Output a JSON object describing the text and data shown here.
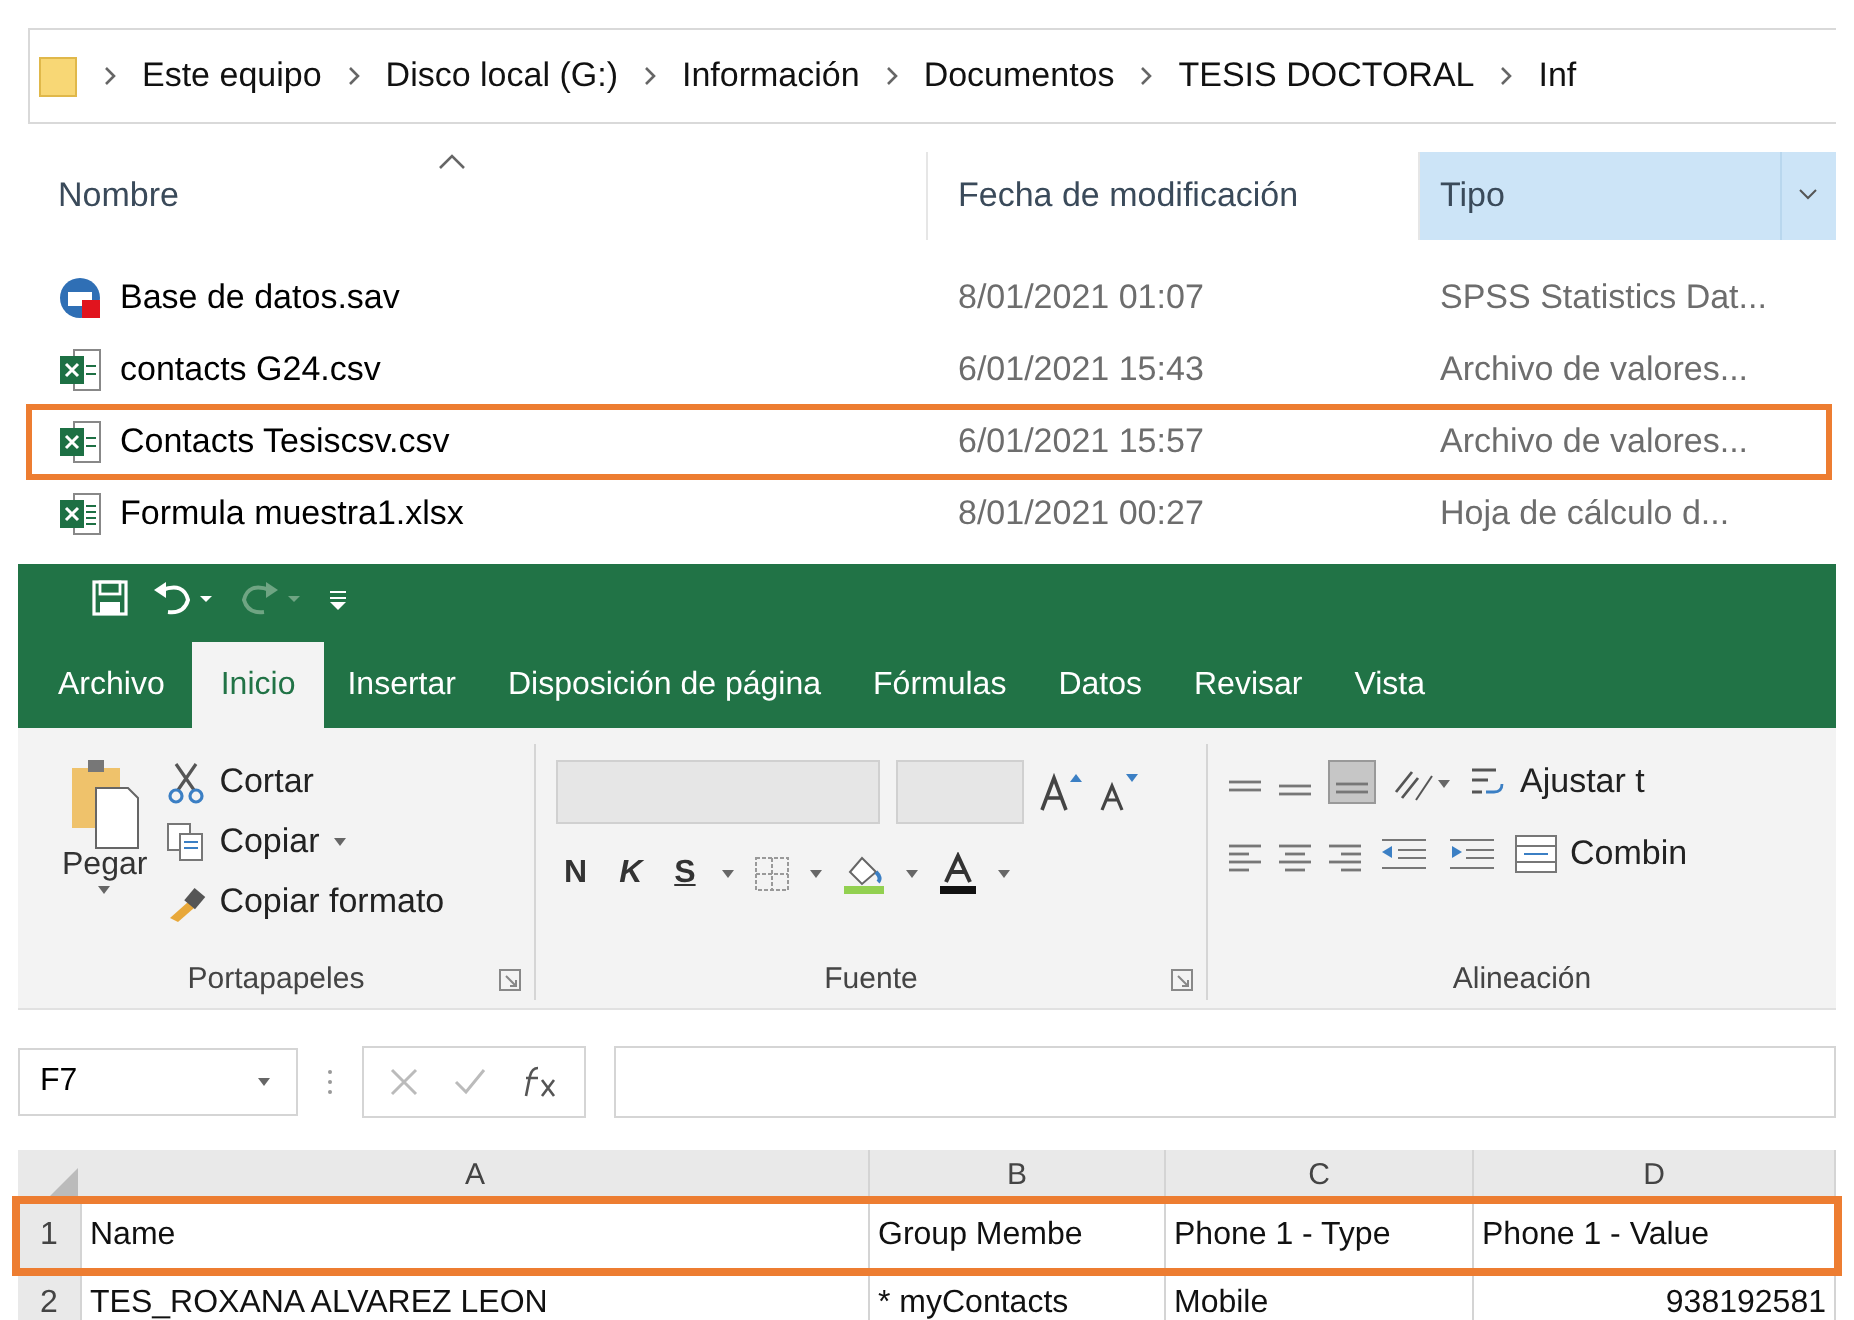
{
  "explorer": {
    "breadcrumb": [
      "Este equipo",
      "Disco local (G:)",
      "Información",
      "Documentos",
      "TESIS DOCTORAL",
      "Inf"
    ],
    "columns": [
      {
        "label": "Nombre",
        "selected": false,
        "sorted": true
      },
      {
        "label": "Fecha de modificación",
        "selected": false,
        "sorted": false
      },
      {
        "label": "Tipo",
        "selected": true,
        "sorted": false
      }
    ],
    "files": [
      {
        "kind": "spss",
        "name": "Base de datos.sav",
        "date": "8/01/2021 01:07",
        "type": "SPSS Statistics Dat...",
        "highlighted": false
      },
      {
        "kind": "csv",
        "name": "contacts G24.csv",
        "date": "6/01/2021 15:43",
        "type": "Archivo de valores...",
        "highlighted": false
      },
      {
        "kind": "csv",
        "name": "Contacts Tesiscsv.csv",
        "date": "6/01/2021 15:57",
        "type": "Archivo de valores...",
        "highlighted": true
      },
      {
        "kind": "xlsx",
        "name": "Formula muestra1.xlsx",
        "date": "8/01/2021 00:27",
        "type": "Hoja de cálculo d...",
        "highlighted": false
      }
    ]
  },
  "excel": {
    "tabs": [
      {
        "label": "Archivo",
        "selected": false
      },
      {
        "label": "Inicio",
        "selected": true
      },
      {
        "label": "Insertar",
        "selected": false
      },
      {
        "label": "Disposición de página",
        "selected": false
      },
      {
        "label": "Fórmulas",
        "selected": false
      },
      {
        "label": "Datos",
        "selected": false
      },
      {
        "label": "Revisar",
        "selected": false
      },
      {
        "label": "Vista",
        "selected": false
      }
    ],
    "clipboard": {
      "paste": "Pegar",
      "cut": "Cortar",
      "copy": "Copiar",
      "format_painter": "Copiar formato",
      "group": "Portapapeles"
    },
    "font": {
      "bold": "N",
      "italic": "K",
      "underline": "S",
      "group": "Fuente"
    },
    "alignment": {
      "wrap": "Ajustar t",
      "merge": "Combin",
      "group": "Alineación"
    },
    "name_box": "F7",
    "columns": [
      "A",
      "B",
      "C",
      "D"
    ],
    "rows": [
      {
        "number": "1",
        "highlighted": true,
        "cells": [
          "Name",
          "Group Membe",
          "Phone 1 - Type",
          "Phone 1 - Value"
        ]
      },
      {
        "number": "2",
        "highlighted": false,
        "cells": [
          "TES_ROXANA ALVAREZ LEON",
          "* myContacts",
          "Mobile",
          "938192581"
        ]
      }
    ]
  }
}
